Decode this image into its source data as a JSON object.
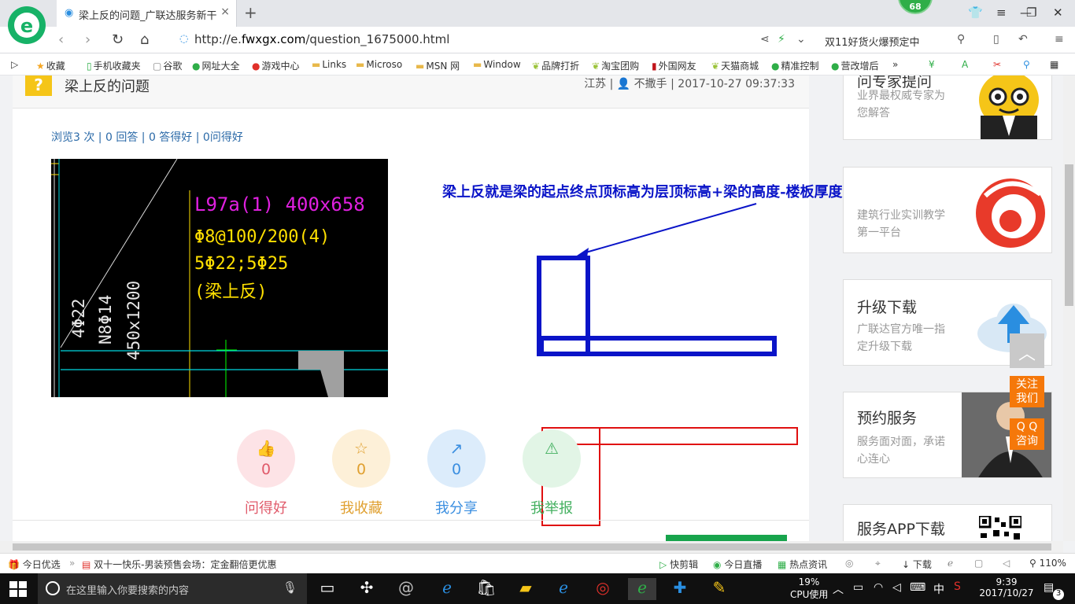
{
  "browser": {
    "tab_title": "梁上反的问题_广联达服务新干线",
    "tab_close": "×",
    "new_tab": "+",
    "badge_count": "68",
    "url_prefix": "http://e.",
    "url_domain": "fwxgx.com",
    "url_path": "/question_1675000.html",
    "promo": "双11好货火爆预定中",
    "logo_letter": "e"
  },
  "bookmarks": [
    {
      "icon": "star-icon",
      "label": "收藏"
    },
    {
      "icon": "mobile-icon",
      "label": "手机收藏夹"
    },
    {
      "icon": "page-icon",
      "label": "谷歌"
    },
    {
      "icon": "globe-icon",
      "label": "网址大全"
    },
    {
      "icon": "game-icon",
      "label": "游戏中心"
    },
    {
      "icon": "folder-icon",
      "label": "Links"
    },
    {
      "icon": "folder-icon",
      "label": "Microso"
    },
    {
      "icon": "folder-icon",
      "label": "MSN 网"
    },
    {
      "icon": "folder-icon",
      "label": "Window"
    },
    {
      "icon": "leaf-icon",
      "label": "品牌打折"
    },
    {
      "icon": "leaf-icon",
      "label": "淘宝团购"
    },
    {
      "icon": "flag-icon",
      "label": "外国网友"
    },
    {
      "icon": "leaf-icon",
      "label": "天猫商城"
    },
    {
      "icon": "chat-icon",
      "label": "精准控制"
    },
    {
      "icon": "chat-icon",
      "label": "营改增后"
    }
  ],
  "bookmarks_more": "»",
  "question": {
    "title": "梁上反的问题",
    "meta": "江苏 | 👤 不撒手 | 2017-10-27 09:37:33",
    "stats": "浏览3 次 | 0 回答 | 0 答得好 | 0问得好",
    "annotation": "梁上反就是梁的起点终点顶标高为层顶标高+梁的高度-楼板厚度"
  },
  "cad": {
    "line1": "L97a(1) 400x658",
    "line2": "Φ8@100/200(4)",
    "line3": "5Φ22;5Φ25",
    "line4": "(梁上反)",
    "vert1": "4Φ22",
    "vert2": "N8Φ14",
    "vert3": "450x1200"
  },
  "actions": [
    {
      "name": "ask-good",
      "icon": "👍",
      "count": "0",
      "label": "问得好",
      "color": "#e05a6a",
      "bg": "#fde3e6"
    },
    {
      "name": "favorite",
      "icon": "☆",
      "count": "0",
      "label": "我收藏",
      "color": "#e0a030",
      "bg": "#fdf0d8"
    },
    {
      "name": "share",
      "icon": "↗",
      "count": "0",
      "label": "我分享",
      "color": "#3a8ee0",
      "bg": "#dcecfb"
    },
    {
      "name": "report",
      "icon": "⚠",
      "count": "",
      "label": "我举报",
      "color": "#44b060",
      "bg": "#e2f5e6"
    }
  ],
  "sidebar": {
    "cards": [
      {
        "title": "问专家提问",
        "desc": "业界最权威专家为您解答"
      },
      {
        "title": "建筑行业实训教学第一平台",
        "desc": "建筑行业实训教学第一平台"
      },
      {
        "title": "升级下载",
        "desc": "广联达官方唯一指定升级下载"
      },
      {
        "title": "预约服务",
        "desc": "服务面对面，承诺心连心"
      },
      {
        "title": "服务APP下载",
        "desc": ""
      }
    ],
    "follow": "关注\n我们",
    "follow_1": "关注",
    "follow_2": "我们",
    "qq_1": "Q Q",
    "qq_2": "咨询",
    "to_top": "︿"
  },
  "statusbar": {
    "left1": "今日优选",
    "left2": "双十一快乐-男装预售会场：定金翻倍更优惠",
    "r1": "快剪辑",
    "r2": "今日直播",
    "r3": "热点资讯",
    "r4": "下载",
    "zoom": "110%"
  },
  "taskbar": {
    "search_placeholder": "在这里输入你要搜索的内容",
    "cpu_percent": "19%",
    "cpu_label": "CPU使用",
    "ime": "中",
    "time": "9:39",
    "date": "2017/10/27",
    "notifications": "3"
  }
}
